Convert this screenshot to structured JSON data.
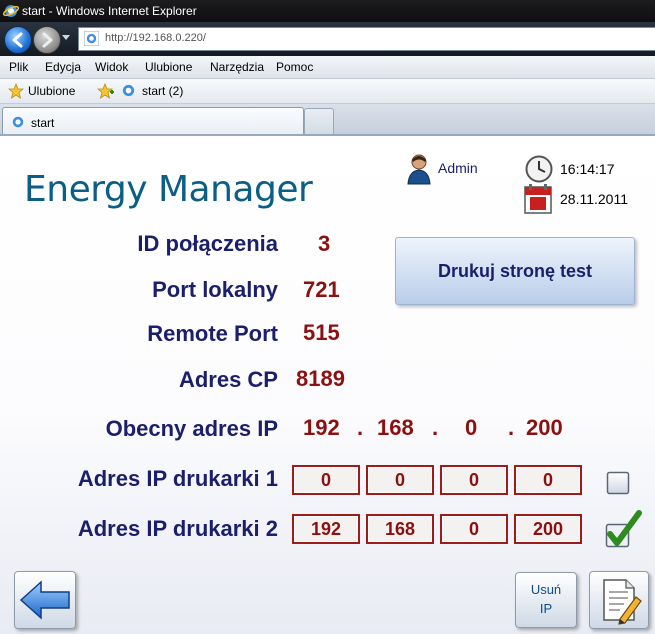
{
  "window": {
    "title": "start - Windows Internet Explorer"
  },
  "address_bar": {
    "url": "http://192.168.0.220/"
  },
  "menu": [
    "Plik",
    "Edycja",
    "Widok",
    "Ulubione",
    "Narzędzia",
    "Pomoc"
  ],
  "favorites": {
    "label": "Ulubione",
    "link": "start (2)"
  },
  "tabs": [
    {
      "label": "start"
    }
  ],
  "app": {
    "title": "Energy Manager",
    "user": "Admin",
    "time": "16:14:17",
    "date": "28.11.2011"
  },
  "fields": [
    {
      "label": "ID połączenia",
      "value": "3"
    },
    {
      "label": "Port lokalny",
      "value": "721"
    },
    {
      "label": "Remote Port",
      "value": "515"
    },
    {
      "label": "Adres CP",
      "value": "8189"
    }
  ],
  "current_ip": {
    "label": "Obecny adres IP",
    "octets": [
      "192",
      "168",
      "0",
      "200"
    ],
    "separator": "."
  },
  "printer1": {
    "label": "Adres IP drukarki 1",
    "octets": [
      "0",
      "0",
      "0",
      "0"
    ],
    "checked": false
  },
  "printer2": {
    "label": "Adres IP drukarki 2",
    "octets": [
      "192",
      "168",
      "0",
      "200"
    ],
    "checked": true
  },
  "buttons": {
    "print_test": "Drukuj stronę test",
    "remove_ip_line1": "Usuń",
    "remove_ip_line2": "IP"
  },
  "colors": {
    "title": "#0b5e86",
    "label": "#1b1f6b",
    "value": "#8b1111",
    "check": "#2e8b1f"
  },
  "icons": [
    "ie-icon",
    "back-arrow-icon",
    "forward-arrow-icon",
    "star-icon",
    "add-favorite-icon",
    "user-icon",
    "clock-icon",
    "calendar-icon",
    "checkbox-icon",
    "checkmark-icon",
    "left-arrow-icon",
    "edit-document-icon"
  ]
}
